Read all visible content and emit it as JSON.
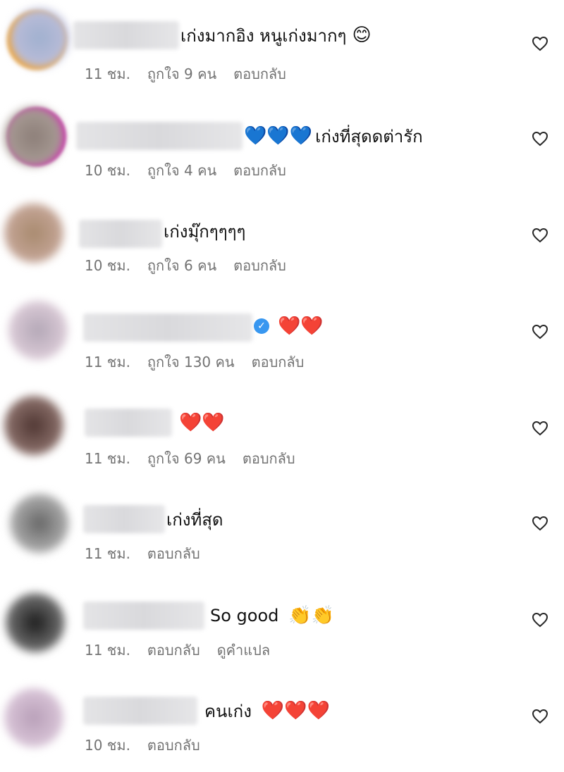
{
  "comments": [
    {
      "text": "เก่งมากอิง หนูเก่งมากๆ",
      "emoji": "😊",
      "time": "11 ชม.",
      "likes": "ถูกใจ 9 คน",
      "reply": "ตอบกลับ",
      "avatar_color": "#a9b8d6"
    },
    {
      "text": "เก่งที่สุดดต่ารัก",
      "emoji": "💙💙💙",
      "time": "10 ชม.",
      "likes": "ถูกใจ 4 คน",
      "reply": "ตอบกลับ",
      "avatar_color": "#8c7e78"
    },
    {
      "text": "เก่งมุ๊กๆๆๆๆ",
      "emoji": "",
      "time": "10 ชม.",
      "likes": "ถูกใจ 6 คน",
      "reply": "ตอบกลับ",
      "avatar_color": "#b8958a"
    },
    {
      "text": "",
      "emoji": "❤️❤️",
      "time": "11 ชม.",
      "likes": "ถูกใจ 130 คน",
      "reply": "ตอบกลับ",
      "avatar_color": "#d9b9c9"
    },
    {
      "text": "",
      "emoji": "❤️❤️",
      "time": "11 ชม.",
      "likes": "ถูกใจ 69 คน",
      "reply": "ตอบกลับ",
      "avatar_color": "#6b4b45"
    },
    {
      "text": "เก่งที่สุด",
      "emoji": "",
      "time": "11 ชม.",
      "likes": "",
      "reply": "ตอบกลับ",
      "avatar_color": "#8a8a8a"
    },
    {
      "text": "So good",
      "emoji": "👏👏",
      "time": "11 ชม.",
      "likes": "",
      "reply": "ตอบกลับ",
      "translate": "ดูคำแปล",
      "avatar_color": "#3c3c3c"
    },
    {
      "text": "คนเก่ง",
      "emoji": "❤️❤️❤️",
      "time": "10 ชม.",
      "likes": "",
      "reply": "ตอบกลับ",
      "avatar_color": "#c9a9c6"
    }
  ],
  "like_icon": "heart-outline-icon"
}
